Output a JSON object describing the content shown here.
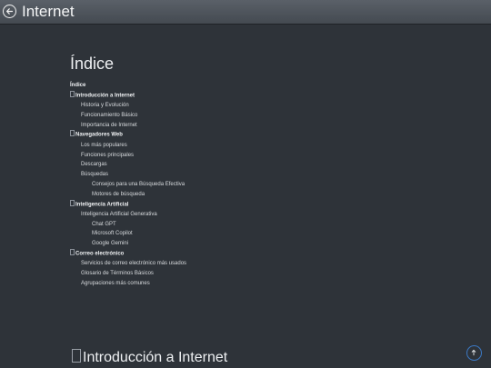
{
  "header": {
    "title": "Internet",
    "back_icon": "back-arrow-icon"
  },
  "index": {
    "title": "Índice",
    "items": [
      {
        "label": "Índice",
        "level": 1,
        "bold": true,
        "glyph": false
      },
      {
        "label": "Introducción a Internet",
        "level": 1,
        "bold": true,
        "glyph": true
      },
      {
        "label": "Historia y Evolución",
        "level": 2,
        "bold": false,
        "glyph": false
      },
      {
        "label": "Funcionamiento Básico",
        "level": 2,
        "bold": false,
        "glyph": false
      },
      {
        "label": "Importancia de Internet",
        "level": 2,
        "bold": false,
        "glyph": false
      },
      {
        "label": "Navegadores Web",
        "level": 1,
        "bold": true,
        "glyph": true
      },
      {
        "label": "Los más populares",
        "level": 2,
        "bold": false,
        "glyph": false
      },
      {
        "label": "Funciones principales",
        "level": 2,
        "bold": false,
        "glyph": false
      },
      {
        "label": "Descargas",
        "level": 2,
        "bold": false,
        "glyph": false
      },
      {
        "label": "Búsquedas",
        "level": 2,
        "bold": false,
        "glyph": false
      },
      {
        "label": "Consejos para una Búsqueda Efectiva",
        "level": 3,
        "bold": false,
        "glyph": false
      },
      {
        "label": "Motores de búsqueda",
        "level": 3,
        "bold": false,
        "glyph": false
      },
      {
        "label": "Inteligencia Artificial",
        "level": 1,
        "bold": true,
        "glyph": true
      },
      {
        "label": "Inteligencia Artificial Generativa",
        "level": 2,
        "bold": false,
        "glyph": false
      },
      {
        "label": "Chat GPT",
        "level": 3,
        "bold": false,
        "glyph": false
      },
      {
        "label": "Microsoft Copilot",
        "level": 3,
        "bold": false,
        "glyph": false
      },
      {
        "label": "Google Gemini",
        "level": 3,
        "bold": false,
        "glyph": false
      },
      {
        "label": "Correo electrónico",
        "level": 1,
        "bold": true,
        "glyph": true
      },
      {
        "label": "Servicios de correo electrónico más usados",
        "level": 2,
        "bold": false,
        "glyph": false
      },
      {
        "label": "Glosario de Términos Básicos",
        "level": 2,
        "bold": false,
        "glyph": false
      },
      {
        "label": "Agrupaciones más comunes",
        "level": 2,
        "bold": false,
        "glyph": false
      }
    ]
  },
  "section": {
    "heading": "Introducción a Internet"
  },
  "scroll_top": {
    "icon": "arrow-up-icon"
  },
  "colors": {
    "background": "#2e3339",
    "topbar": "#4d535a",
    "accent": "#3b78c2"
  }
}
